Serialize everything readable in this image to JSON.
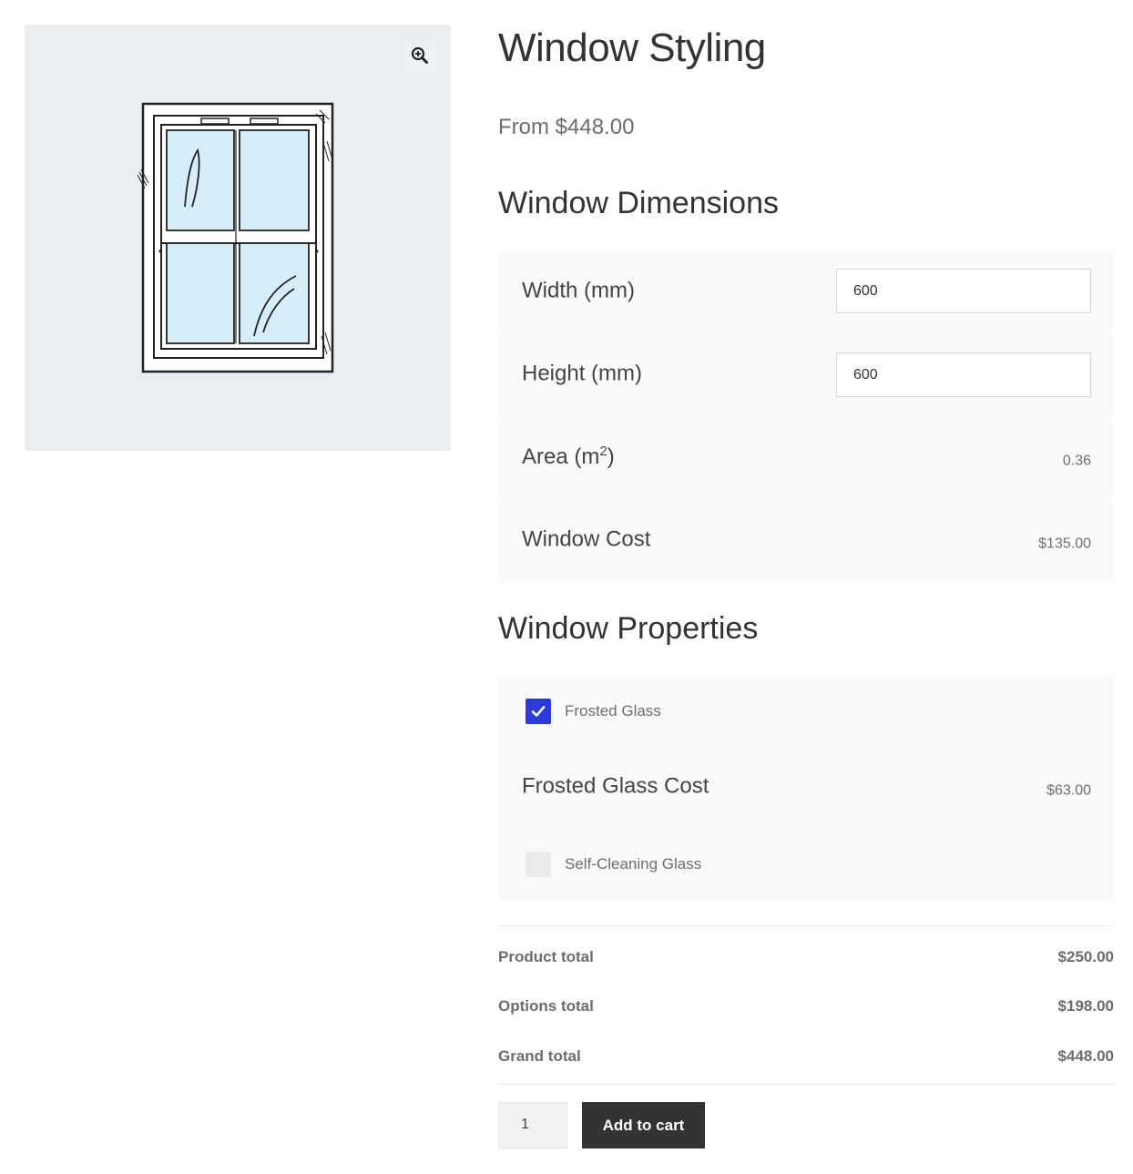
{
  "product": {
    "title": "Window Styling",
    "price": "From $448.00"
  },
  "gallery": {
    "zoom_icon": "zoom-in-magnifier-icon",
    "image": "sash-window-illustration"
  },
  "dimensions": {
    "title": "Window Dimensions",
    "width_label": "Width (mm)",
    "width_value": "600",
    "height_label": "Height (mm)",
    "height_value": "600",
    "area_label": "Area (m",
    "area_superscript": "2",
    "area_label_end": ")",
    "area_value": "0.36",
    "cost_label": "Window Cost",
    "cost_value": "$135.00"
  },
  "properties": {
    "title": "Window Properties",
    "frosted_label": "Frosted Glass",
    "frosted_checked": true,
    "frosted_cost_label": "Frosted Glass Cost",
    "frosted_cost_value": "$63.00",
    "self_cleaning_label": "Self-Cleaning Glass",
    "self_cleaning_checked": false
  },
  "totals": {
    "product_label": "Product total",
    "product_value": "$250.00",
    "options_label": "Options total",
    "options_value": "$198.00",
    "grand_label": "Grand total",
    "grand_value": "$448.00"
  },
  "cart": {
    "quantity": "1",
    "add_label": "Add to cart"
  },
  "colors": {
    "accent": "#2b3bdb",
    "button": "#333333",
    "gallery_bg": "#e9eef2",
    "glass": "#d6eefa"
  }
}
